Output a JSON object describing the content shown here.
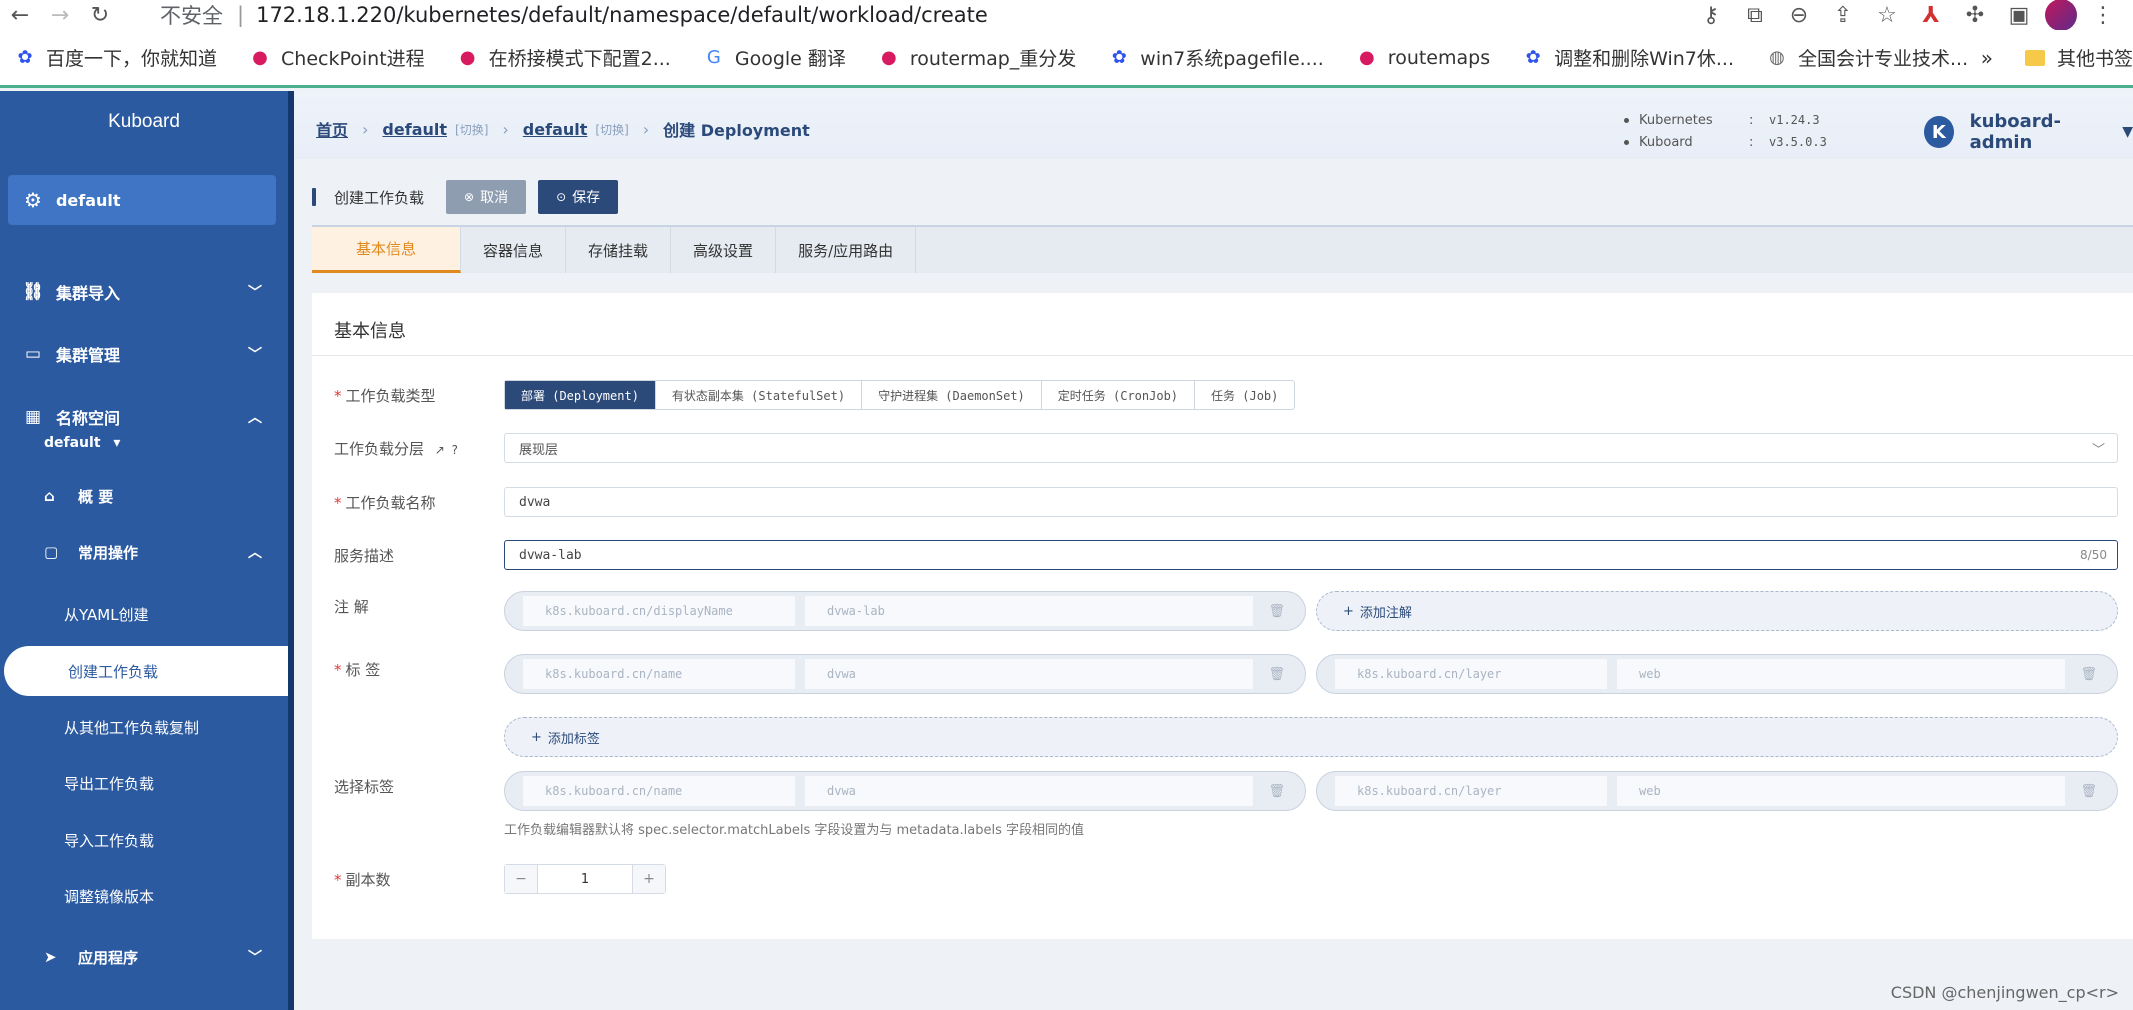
{
  "browser": {
    "insecure_label": "不安全",
    "separator": "|",
    "url": "172.18.1.220/kubernetes/default/namespace/default/workload/create",
    "bookmarks": [
      {
        "icon": "baidu-paw-icon",
        "label": "百度一下，你就知道"
      },
      {
        "icon": "dot-icon",
        "label": "CheckPoint进程"
      },
      {
        "icon": "dot-icon",
        "label": "在桥接模式下配置2..."
      },
      {
        "icon": "google-translate-icon",
        "label": "Google 翻译"
      },
      {
        "icon": "dot-icon",
        "label": "routermap_重分发"
      },
      {
        "icon": "baidu-paw-icon",
        "label": "win7系统pagefile...."
      },
      {
        "icon": "dot-icon",
        "label": "routemaps"
      },
      {
        "icon": "baidu-paw-icon",
        "label": "调整和删除Win7休..."
      },
      {
        "icon": "globe-icon",
        "label": "全国会计专业技术..."
      }
    ],
    "more": "»",
    "other_bookmarks": "其他书签"
  },
  "sidebar": {
    "logo": "Kuboard",
    "namespace": "default",
    "items": [
      {
        "label": "集群导入"
      },
      {
        "label": "集群管理"
      },
      {
        "label": "名称空间"
      }
    ],
    "ns_select": "default",
    "overview": "概 要",
    "common_ops": "常用操作",
    "sub_items": [
      {
        "label": "从YAML创建"
      },
      {
        "label": "创建工作负载"
      },
      {
        "label": "从其他工作负载复制"
      },
      {
        "label": "导出工作负载"
      },
      {
        "label": "导入工作负载"
      },
      {
        "label": "调整镜像版本"
      }
    ],
    "apps": "应用程序"
  },
  "header": {
    "breadcrumb": {
      "home": "首页",
      "cluster": "default",
      "cluster_switch": "[切换]",
      "ns": "default",
      "ns_switch": "[切换]",
      "current": "创建 Deployment"
    },
    "versions": [
      {
        "name": "Kubernetes",
        "colon": ":",
        "value": "v1.24.3"
      },
      {
        "name": "Kuboard",
        "colon": ":",
        "value": "v3.5.0.3"
      }
    ],
    "user": {
      "initial": "K",
      "name": "kuboard-admin"
    }
  },
  "actionbar": {
    "title": "创建工作负载",
    "cancel": "取消",
    "save": "保存"
  },
  "tabs": [
    "基本信息",
    "容器信息",
    "存储挂载",
    "高级设置",
    "服务/应用路由"
  ],
  "form": {
    "section_title": "基本信息",
    "type_label": "工作负载类型",
    "types": [
      "部署 (Deployment)",
      "有状态副本集 (StatefulSet)",
      "守护进程集 (DaemonSet)",
      "定时任务 (CronJob)",
      "任务 (Job)"
    ],
    "layer_label": "工作负载分层",
    "layer_value": "展现层",
    "name_label": "工作负载名称",
    "name_value": "dvwa",
    "desc_label": "服务描述",
    "desc_value": "dvwa-lab",
    "desc_counter": "8/50",
    "annot_label": "注 解",
    "annot_key": "k8s.kuboard.cn/displayName",
    "annot_val": "dvwa-lab",
    "add_annot": "添加注解",
    "labels_label": "标 签",
    "labels": [
      {
        "key": "k8s.kuboard.cn/name",
        "val": "dvwa"
      },
      {
        "key": "k8s.kuboard.cn/layer",
        "val": "web"
      }
    ],
    "add_label": "添加标签",
    "selector_label": "选择标签",
    "selectors": [
      {
        "key": "k8s.kuboard.cn/name",
        "val": "dvwa"
      },
      {
        "key": "k8s.kuboard.cn/layer",
        "val": "web"
      }
    ],
    "selector_hint": "工作负载编辑器默认将 spec.selector.matchLabels 字段设置为与 metadata.labels 字段相同的值",
    "replicas_label": "副本数",
    "replicas_value": "1",
    "minus": "−",
    "plus": "+"
  },
  "watermark": "CSDN @chenjingwen_cp<r>"
}
